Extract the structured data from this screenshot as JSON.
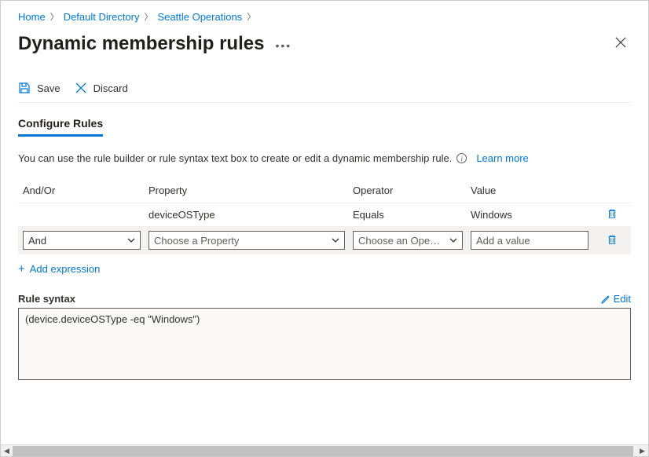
{
  "breadcrumb": {
    "home": "Home",
    "dir": "Default Directory",
    "group": "Seattle Operations"
  },
  "page_title": "Dynamic membership rules",
  "toolbar": {
    "save": "Save",
    "discard": "Discard"
  },
  "tab_label": "Configure Rules",
  "helper_text": "You can use the rule builder or rule syntax text box to create or edit a dynamic membership rule.",
  "learn_more": "Learn more",
  "columns": {
    "andor": "And/Or",
    "property": "Property",
    "operator": "Operator",
    "value": "Value"
  },
  "rows": [
    {
      "andor": "",
      "property": "deviceOSType",
      "operator": "Equals",
      "value": "Windows"
    }
  ],
  "editing_row": {
    "andor_selected": "And",
    "property_placeholder": "Choose a Property",
    "operator_placeholder": "Choose an Ope…",
    "value_placeholder": "Add a value"
  },
  "add_expression": "Add expression",
  "rule_syntax_label": "Rule syntax",
  "edit_label": "Edit",
  "rule_syntax_value": "(device.deviceOSType -eq \"Windows\")"
}
